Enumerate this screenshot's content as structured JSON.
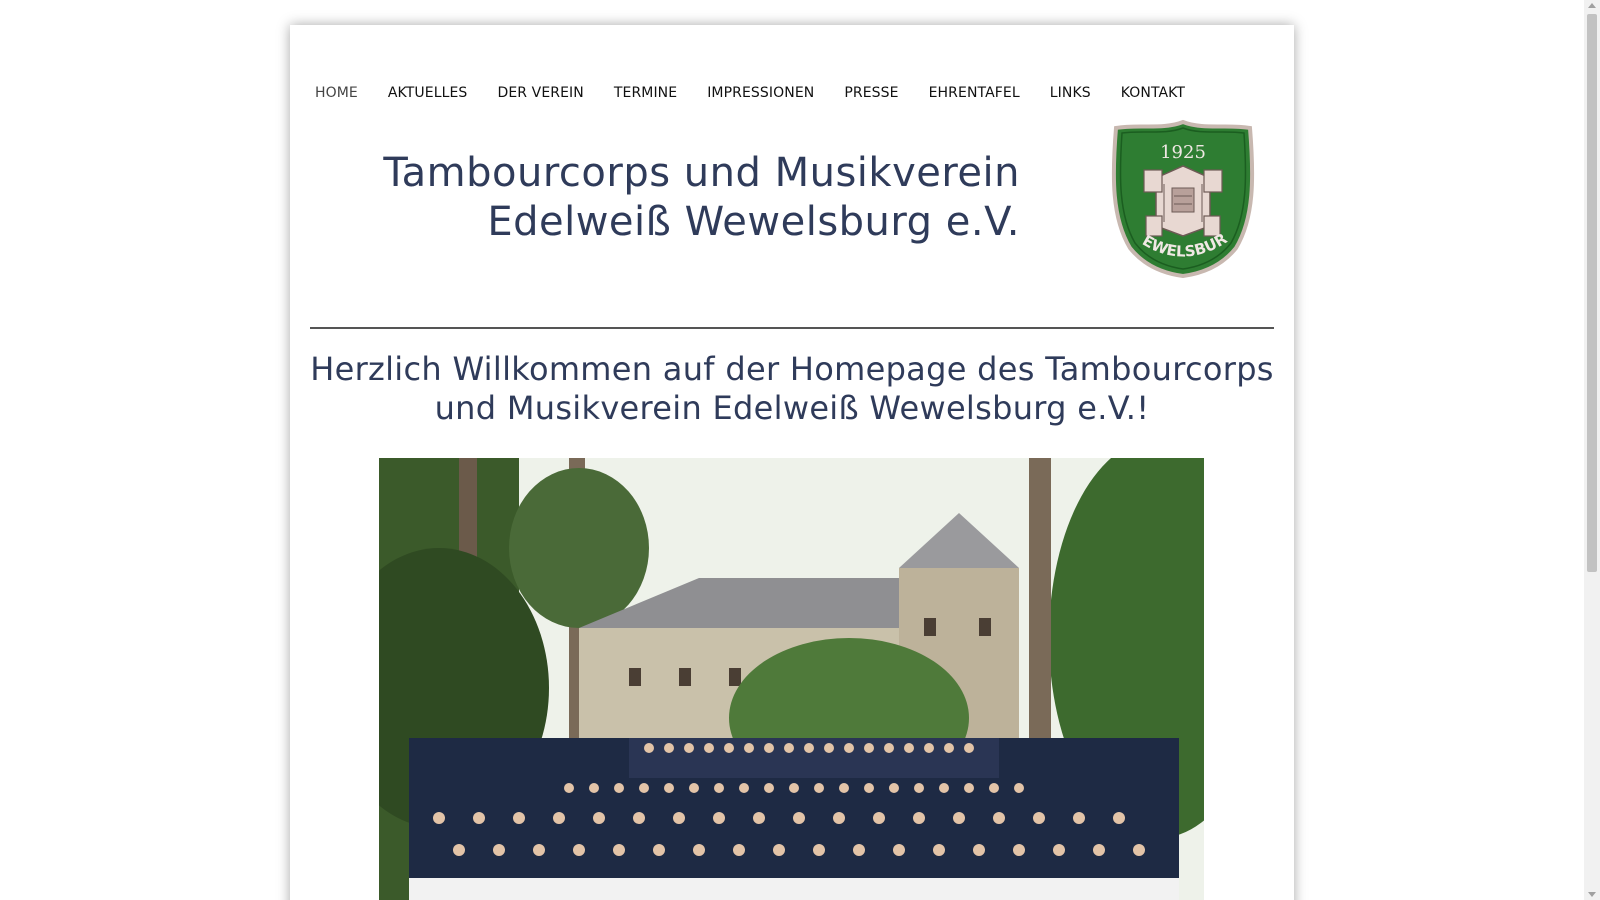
{
  "nav": {
    "items": [
      {
        "label": "HOME",
        "active": true
      },
      {
        "label": "AKTUELLES"
      },
      {
        "label": "DER VEREIN"
      },
      {
        "label": "TERMINE"
      },
      {
        "label": "IMPRESSIONEN"
      },
      {
        "label": "PRESSE"
      },
      {
        "label": "EHRENTAFEL"
      },
      {
        "label": "LINKS"
      },
      {
        "label": "KONTAKT"
      }
    ]
  },
  "header": {
    "title_line1": "Tambourcorps und Musikverein",
    "title_line2": "Edelweiß Wewelsburg e.V.",
    "logo": {
      "year": "1925",
      "name": "WEWELSBURG",
      "color_green": "#2e7d32",
      "color_border": "#c8b8b0"
    }
  },
  "main": {
    "welcome_line1": "Herzlich Willkommen auf der Homepage des Tambourcorps",
    "welcome_line2": "und Musikverein Edelweiß Wewelsburg e.V.!",
    "photo_icon": "group-photo"
  },
  "colors": {
    "heading": "#2f3b5a",
    "nav_text": "#111111",
    "divider": "#555555"
  }
}
